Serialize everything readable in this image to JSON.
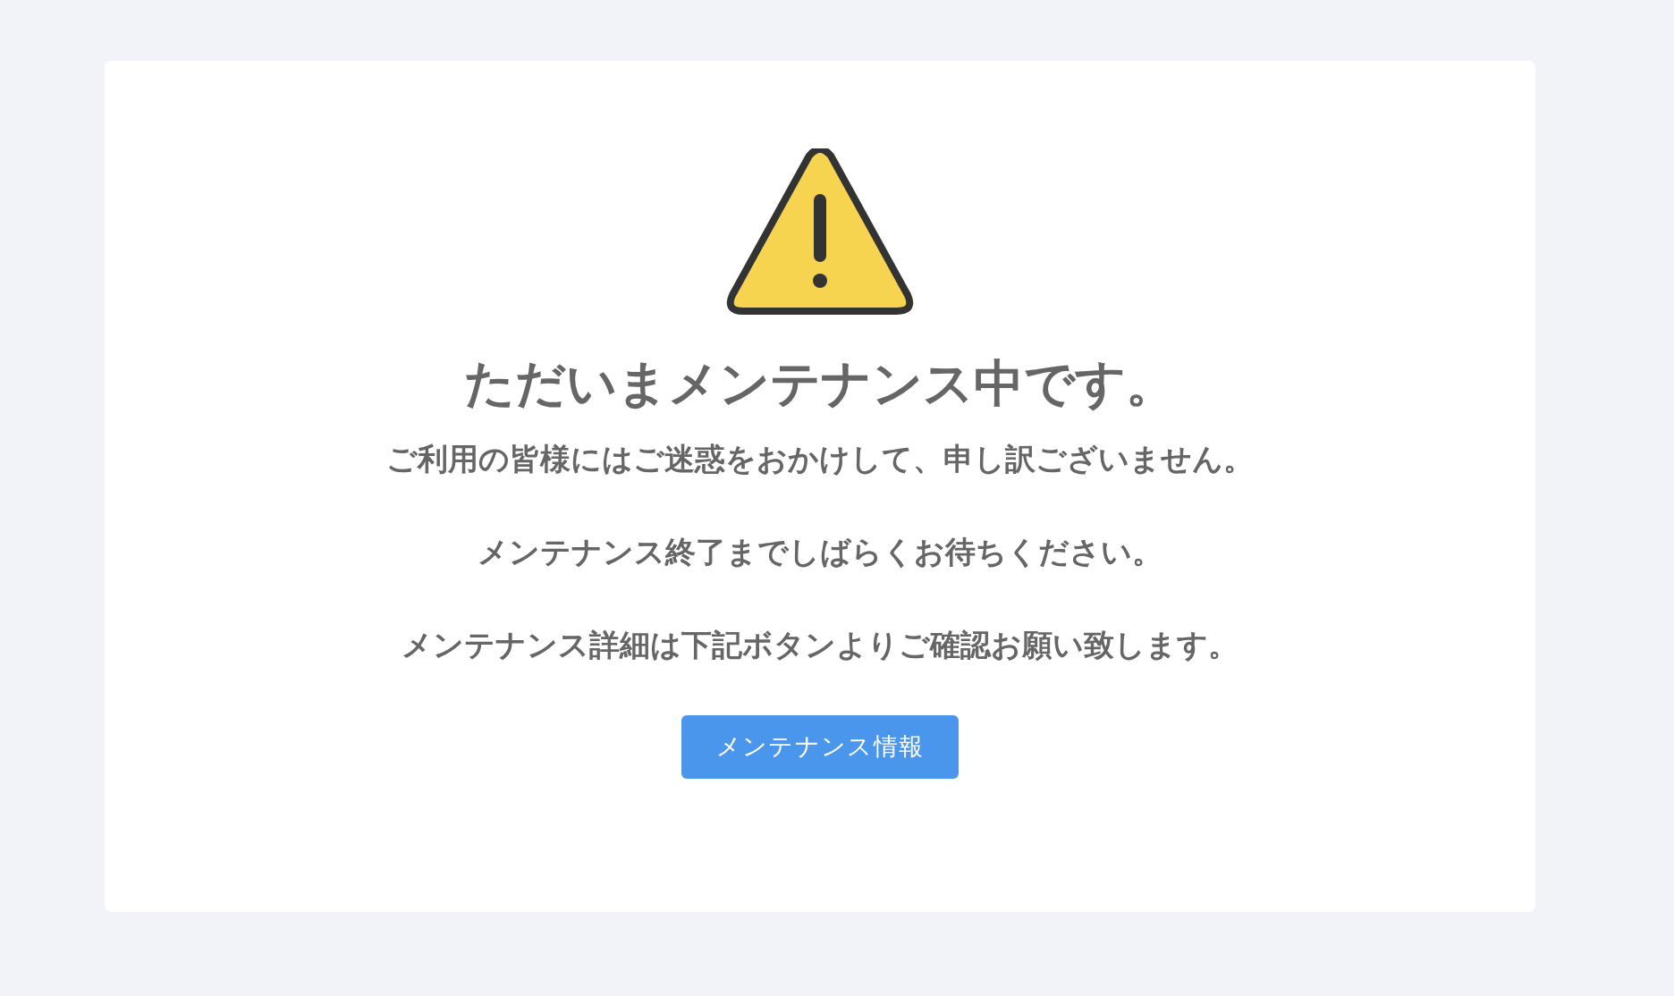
{
  "heading": "ただいまメンテナンス中です。",
  "messages": [
    "ご利用の皆様にはご迷惑をおかけして、申し訳ございません。",
    "メンテナンス終了までしばらくお待ちください。",
    "メンテナンス詳細は下記ボタンよりご確認お願い致します。"
  ],
  "button": {
    "label": "メンテナンス情報"
  }
}
